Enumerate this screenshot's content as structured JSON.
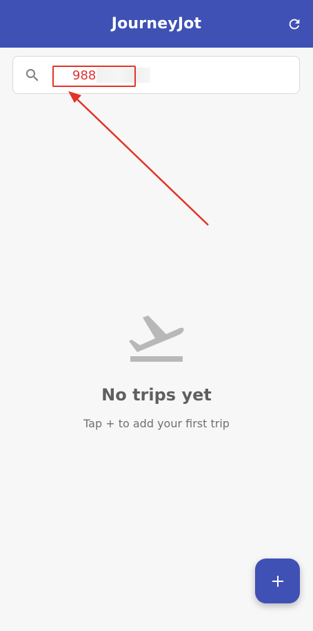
{
  "appbar": {
    "title": "JourneyJot",
    "refresh_icon": "refresh-icon",
    "background": "#3f51b5"
  },
  "search": {
    "icon": "search-icon",
    "value": "988"
  },
  "empty_state": {
    "icon": "flight-takeoff-icon",
    "title": "No trips yet",
    "subtitle": "Tap + to add your first trip"
  },
  "fab": {
    "icon": "plus-icon",
    "color": "#3f51b5"
  },
  "annotation_color": "#e33227"
}
